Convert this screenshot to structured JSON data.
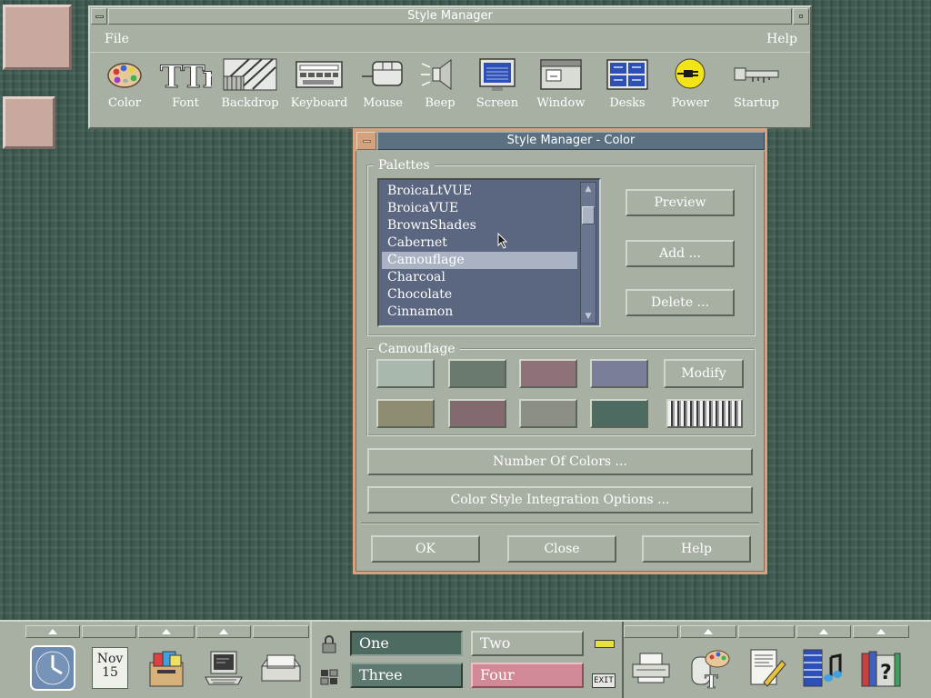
{
  "style_manager": {
    "title": "Style Manager",
    "menu": {
      "file": "File",
      "help": "Help"
    },
    "tools": [
      {
        "label": "Color",
        "icon": "color-palette-icon"
      },
      {
        "label": "Font",
        "icon": "font-icon",
        "glyph": "TTr"
      },
      {
        "label": "Backdrop",
        "icon": "backdrop-icon"
      },
      {
        "label": "Keyboard",
        "icon": "keyboard-icon"
      },
      {
        "label": "Mouse",
        "icon": "mouse-icon"
      },
      {
        "label": "Beep",
        "icon": "speaker-icon"
      },
      {
        "label": "Screen",
        "icon": "screen-icon"
      },
      {
        "label": "Window",
        "icon": "window-icon"
      },
      {
        "label": "Desks",
        "icon": "desks-icon"
      },
      {
        "label": "Power",
        "icon": "power-plug-icon"
      },
      {
        "label": "Startup",
        "icon": "key-icon"
      }
    ]
  },
  "color_dialog": {
    "title": "Style Manager - Color",
    "palettes_legend": "Palettes",
    "palettes": [
      "BroicaLtVUE",
      "BroicaVUE",
      "BrownShades",
      "Cabernet",
      "Camouflage",
      "Charcoal",
      "Chocolate",
      "Cinnamon"
    ],
    "selected_palette": "Camouflage",
    "preview_label": "Preview",
    "add_label": "Add ...",
    "delete_label": "Delete ...",
    "palette_group_legend": "Camouflage",
    "swatches_row1": [
      "#a9b8ad",
      "#6a7a6f",
      "#8f7277",
      "#7b7e98"
    ],
    "swatches_row2": [
      "#8e8d72",
      "#836a6e",
      "#8b8f85",
      "#4e6b62"
    ],
    "modify_label": "Modify",
    "number_of_colors_label": "Number Of Colors ...",
    "integration_label": "Color Style Integration Options ...",
    "ok_label": "OK",
    "close_label": "Close",
    "help_label": "Help"
  },
  "front_panel": {
    "calendar_month": "Nov",
    "calendar_day": "15",
    "workspaces": [
      "One",
      "Two",
      "Three",
      "Four"
    ],
    "exit_label": "EXIT"
  },
  "colors": {
    "desktop": "#3d5a50",
    "window_bg": "#a8b0a4",
    "title_active": "#5b7081",
    "list_bg": "#5b6680",
    "list_selected": "#aab3c4",
    "dialog_border": "#d4a27f",
    "desktop_swatch": "#c7a9a0"
  }
}
